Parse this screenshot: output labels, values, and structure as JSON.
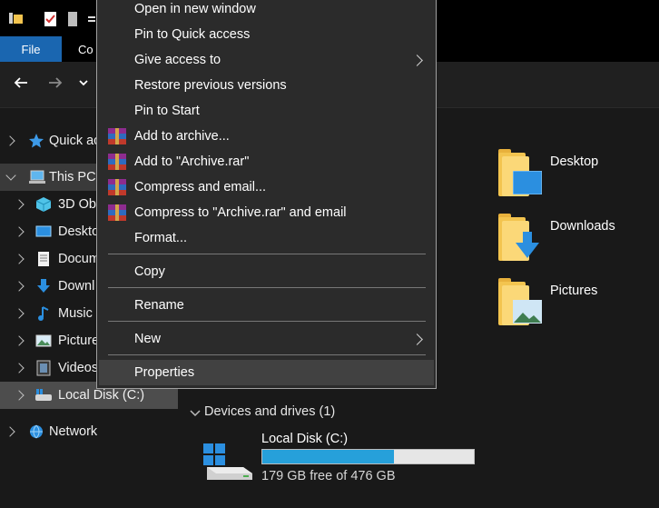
{
  "ribbon": {
    "file_label": "File",
    "computer_label": "Co"
  },
  "sidebar": {
    "items": [
      {
        "label": "Quick ac",
        "icon": "star-icon"
      },
      {
        "label": "This PC",
        "icon": "computer-icon"
      },
      {
        "label": "3D Ob",
        "icon": "cube-icon"
      },
      {
        "label": "Deskto",
        "icon": "desktop-icon"
      },
      {
        "label": "Docum",
        "icon": "document-icon"
      },
      {
        "label": "Downl",
        "icon": "download-icon"
      },
      {
        "label": "Music",
        "icon": "music-icon"
      },
      {
        "label": "Picture",
        "icon": "picture-icon"
      },
      {
        "label": "Videos",
        "icon": "video-icon"
      },
      {
        "label": "Local Disk (C:)",
        "icon": "drive-icon"
      },
      {
        "label": "Network",
        "icon": "network-icon"
      }
    ]
  },
  "main": {
    "folders": [
      {
        "label": "Desktop"
      },
      {
        "label": "Downloads"
      },
      {
        "label": "Pictures"
      }
    ],
    "devices_header": "Devices and drives (1)",
    "drive": {
      "name": "Local Disk (C:)",
      "free_text": "179 GB free of 476 GB",
      "used_fraction": 0.624
    }
  },
  "context_menu": {
    "items": [
      {
        "label": "Open in new window"
      },
      {
        "label": "Pin to Quick access"
      },
      {
        "label": "Give access to",
        "submenu": true
      },
      {
        "label": "Restore previous versions"
      },
      {
        "label": "Pin to Start"
      },
      {
        "label": "Add to archive...",
        "icon": "winrar-icon"
      },
      {
        "label": "Add to \"Archive.rar\"",
        "icon": "winrar-icon"
      },
      {
        "label": "Compress and email...",
        "icon": "winrar-icon"
      },
      {
        "label": "Compress to \"Archive.rar\" and email",
        "icon": "winrar-icon"
      },
      {
        "label": "Format..."
      },
      {
        "label": "Copy"
      },
      {
        "label": "Rename"
      },
      {
        "label": "New",
        "submenu": true
      },
      {
        "label": "Properties"
      }
    ]
  },
  "colors": {
    "accent": "#1a66b0",
    "progress": "#26a0da",
    "folder": "#f3c44f"
  }
}
